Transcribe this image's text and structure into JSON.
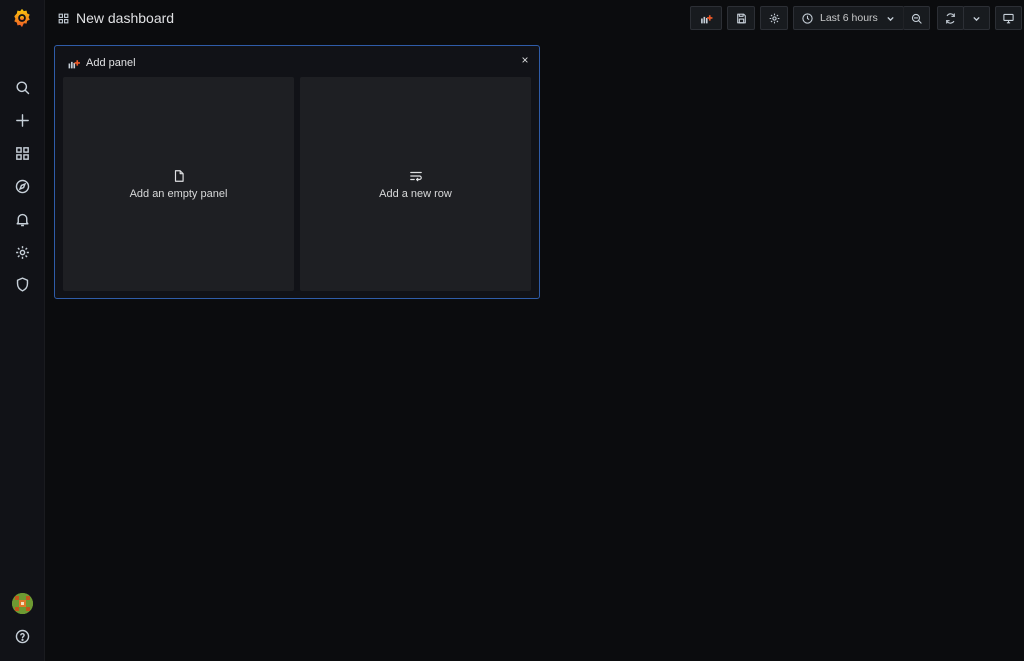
{
  "header": {
    "title": "New dashboard"
  },
  "toolbar": {
    "time_range": "Last 6 hours"
  },
  "add_panel": {
    "title": "Add panel",
    "close_glyph": "×",
    "options": [
      {
        "label": "Add an empty panel",
        "icon": "file-icon"
      },
      {
        "label": "Add a new row",
        "icon": "wrap-text-icon"
      }
    ]
  },
  "sidebar": {
    "items": [
      "search-icon",
      "plus-icon",
      "dashboards-icon",
      "compass-icon",
      "bell-icon",
      "gear-icon",
      "shield-icon"
    ]
  },
  "colors": {
    "accent_orange": "#f05a28",
    "logo_yellow": "#fbca0a",
    "panel_border": "#2f5ca8",
    "background": "#0b0c0e"
  }
}
